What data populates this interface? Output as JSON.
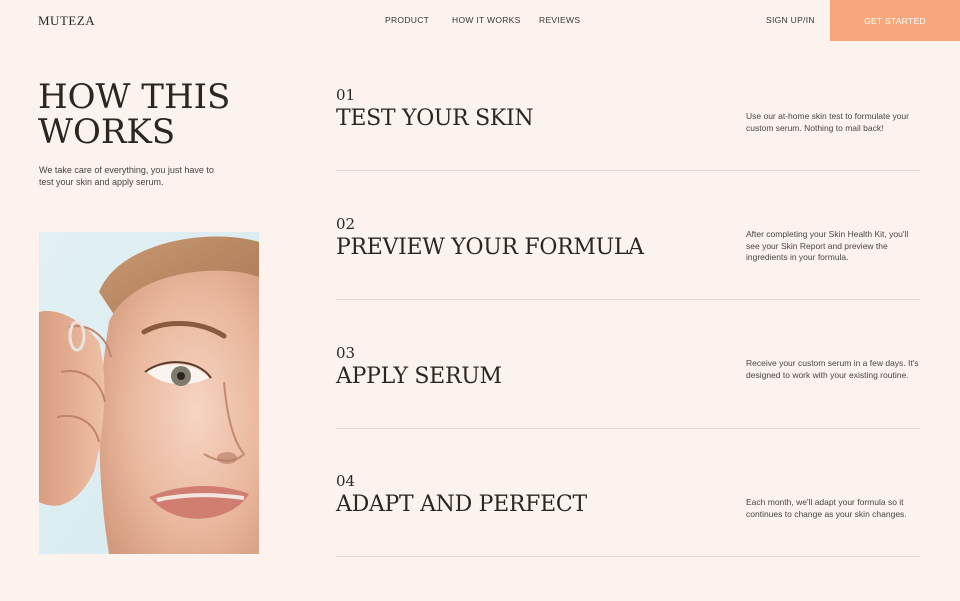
{
  "header": {
    "brand": "MUTEZA",
    "nav": [
      "PRODUCT",
      "HOW IT WORKS",
      "REVIEWS"
    ],
    "signup": "SIGN UP/IN",
    "cta": "GET STARTED"
  },
  "hero": {
    "title_line1": "HOW THIS",
    "title_line2": "WORKS",
    "subtitle": "We take care of everything, you just have to test your skin and apply serum."
  },
  "steps": [
    {
      "number": "01",
      "title": "TEST YOUR SKIN",
      "description": "Use our at-home skin test to formulate your custom serum. Nothing to mail back!"
    },
    {
      "number": "02",
      "title": "PREVIEW YOUR FORMULA",
      "description": "After completing your Skin Health Kit, you'll see your Skin Report and preview the ingredients in your formula."
    },
    {
      "number": "03",
      "title": "APPLY SERUM",
      "description": "Receive your custom serum in a few days. It's designed to work with your existing routine."
    },
    {
      "number": "04",
      "title": "ADAPT AND PERFECT",
      "description": "Each month, we'll adapt your formula so it continues to change as your skin changes."
    }
  ],
  "colors": {
    "background": "#fdf3ee",
    "accent": "#f8a77c",
    "text": "#2a2622",
    "divider": "#e2d6cf"
  }
}
